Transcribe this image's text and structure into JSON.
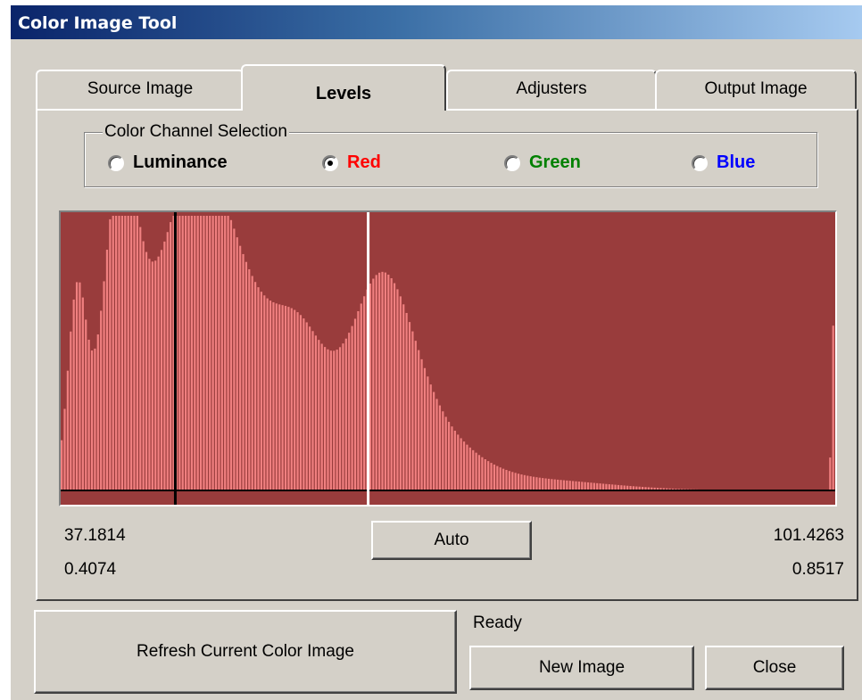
{
  "window": {
    "title": "Color Image Tool"
  },
  "tabs": [
    {
      "label": "Source Image",
      "active": false
    },
    {
      "label": "Levels",
      "active": true
    },
    {
      "label": "Adjusters",
      "active": false
    },
    {
      "label": "Output Image",
      "active": false
    }
  ],
  "channel_group": {
    "label": "Color Channel Selection",
    "options": [
      {
        "label": "Luminance",
        "color": "#000000",
        "selected": false
      },
      {
        "label": "Red",
        "color": "#ff0000",
        "selected": true
      },
      {
        "label": "Green",
        "color": "#008000",
        "selected": false
      },
      {
        "label": "Blue",
        "color": "#0000ff",
        "selected": false
      }
    ]
  },
  "histogram": {
    "background": "#993c3c",
    "bar_color": "#f08080",
    "bins": 256,
    "black_point_fraction": 0.4074,
    "white_point_fraction": 0.8517,
    "black_marker_color": "#000000",
    "white_marker_color": "#ffffff"
  },
  "levels": {
    "low_value": "37.1814",
    "high_value": "101.4263",
    "low_fraction": "0.4074",
    "high_fraction": "0.8517",
    "auto_label": "Auto"
  },
  "footer": {
    "refresh_label": "Refresh Current Color Image",
    "status": "Ready",
    "new_image_label": "New Image",
    "close_label": "Close"
  }
}
